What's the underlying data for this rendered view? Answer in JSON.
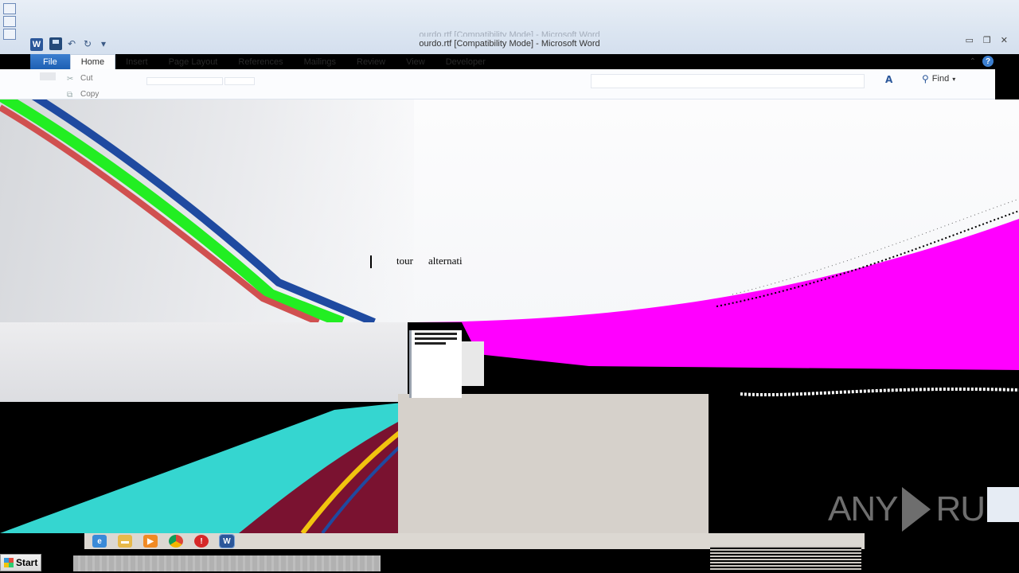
{
  "window": {
    "title": "ourdo.rtf [Compatibility Mode] - Microsoft Word",
    "app_icon": "W",
    "controls": [
      "minimize-icon",
      "restore-icon",
      "close-icon"
    ]
  },
  "qat": {
    "items": [
      "save-icon",
      "undo-icon",
      "redo-icon",
      "customize-icon"
    ]
  },
  "ribbon": {
    "tabs": [
      {
        "label": "File"
      },
      {
        "label": "Home"
      },
      {
        "label": "Insert"
      },
      {
        "label": "Page Layout"
      },
      {
        "label": "References"
      },
      {
        "label": "Mailings"
      },
      {
        "label": "Review"
      },
      {
        "label": "View"
      },
      {
        "label": "Developer"
      }
    ],
    "active_tab": "Home",
    "clipboard": {
      "cut_label": "Cut",
      "copy_label": "Copy"
    },
    "editing": {
      "find_label": "Find"
    }
  },
  "document": {
    "words": [
      "tour",
      "alternati"
    ]
  },
  "taskbar": {
    "start_label": "Start",
    "icons": [
      "ie-icon",
      "explorer-icon",
      "media-icon",
      "chrome-icon",
      "antivirus-icon",
      "word-icon"
    ]
  },
  "watermark": {
    "left": "ANY",
    "right": "RUN"
  },
  "colors": {
    "file_tab": "#2b6cc4",
    "artifact_magenta": "#ff00ff",
    "artifact_green": "#22ee22",
    "artifact_blue": "#1f4aa0",
    "artifact_red": "#d05050",
    "artifact_cyan": "#35d6d0"
  }
}
